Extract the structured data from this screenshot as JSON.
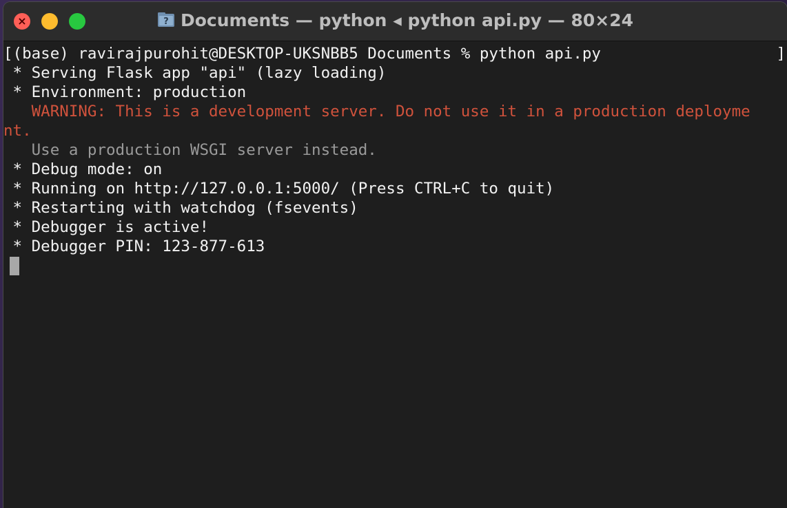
{
  "window": {
    "title": "Documents — python ◂ python api.py — 80×24",
    "close_glyph": "×"
  },
  "terminal": {
    "lines": [
      "[(base) ravirajpurohit@DESKTOP-UKSNBB5 Documents % python api.py",
      " * Serving Flask app \"api\" (lazy loading)",
      " * Environment: production",
      "   WARNING: This is a development server. Do not use it in a production deployme",
      "nt.",
      "   Use a production WSGI server instead.",
      " * Debug mode: on",
      " * Running on http://127.0.0.1:5000/ (Press CTRL+C to quit)",
      " * Restarting with watchdog (fsevents)",
      " * Debugger is active!",
      " * Debugger PIN: 123-877-613"
    ],
    "right_bracket": "]"
  },
  "colors": {
    "warning": "#d0523c",
    "dim": "#9a9a9a",
    "text": "#f2f2f2",
    "background": "#1e1e1e"
  }
}
